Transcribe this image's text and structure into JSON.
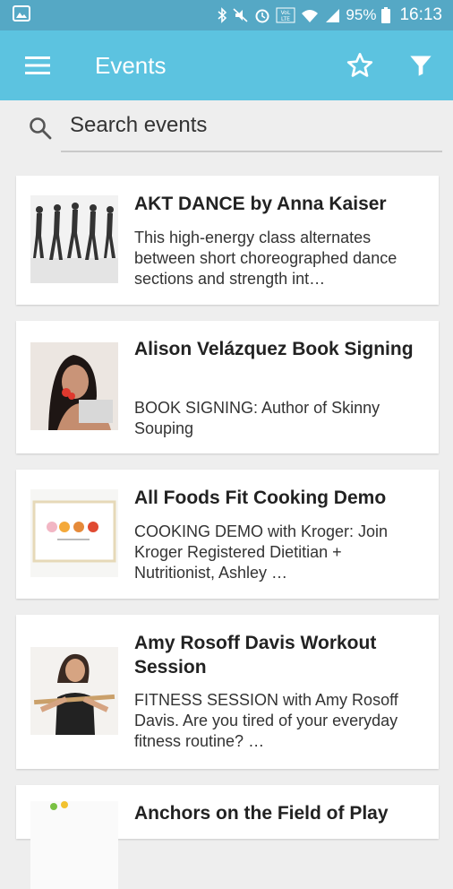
{
  "status_bar": {
    "battery": "95%",
    "time": "16:13",
    "icons": [
      "image-icon",
      "bluetooth-icon",
      "mute-icon",
      "alarm-icon",
      "volte-icon",
      "wifi-icon",
      "signal-icon",
      "battery-icon"
    ]
  },
  "app_bar": {
    "title": "Events",
    "actions": [
      "menu-icon",
      "star-icon",
      "filter-icon"
    ]
  },
  "search": {
    "placeholder": "Search events"
  },
  "events": [
    {
      "name": "AKT DANCE by Anna Kaiser",
      "description": "This high-energy class alternates between short choreographed dance sections and strength int…"
    },
    {
      "name": "Alison Velázquez Book Signing",
      "description": "BOOK SIGNING: Author of Skinny Souping"
    },
    {
      "name": "All Foods Fit Cooking Demo",
      "description": "COOKING DEMO with Kroger: Join Kroger Registered Dietitian + Nutritionist, Ashley …"
    },
    {
      "name": "Amy Rosoff Davis Workout Session",
      "description": "FITNESS SESSION with Amy Rosoff Davis. Are you tired of your everyday fitness routine? …"
    },
    {
      "name": "Anchors on the Field of Play",
      "description": ""
    }
  ]
}
